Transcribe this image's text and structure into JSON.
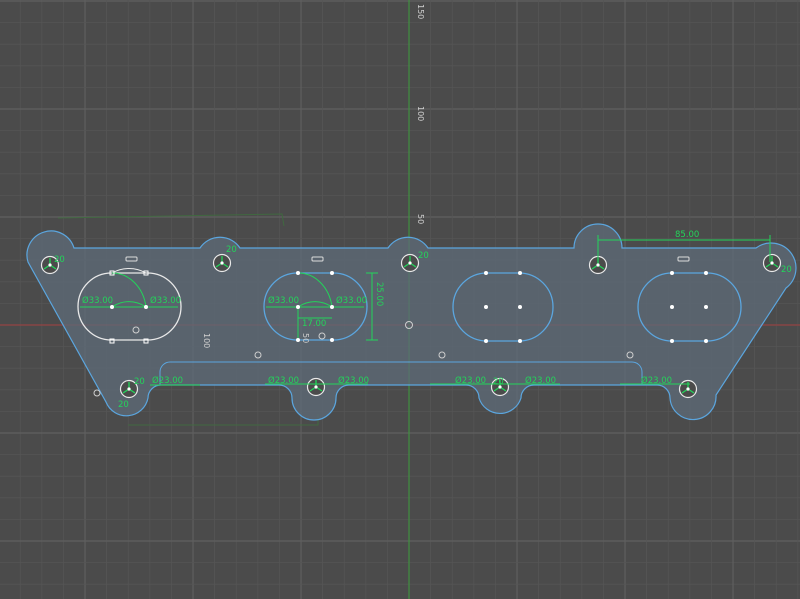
{
  "colors": {
    "background": "#4b4b4b",
    "grid_minor": "#555555",
    "grid_major": "#5f5f5f",
    "axis_y": "#3a9b3a",
    "axis_x": "#a23b3b",
    "profile_fill": "#5d6b78",
    "profile_stroke": "#5ba6df",
    "sketch_stroke": "#e9e9e9",
    "dimension": "#23d45a"
  },
  "axis_labels": {
    "y150": "150",
    "y100": "100",
    "y50": "50",
    "x100": "100",
    "x50": "50"
  },
  "dimensions": {
    "d1": "Ø33.00",
    "d2": "Ø33.00",
    "d3": "Ø33.00",
    "d4": "Ø33.00",
    "h25": "25.00",
    "w17": "17.00",
    "span85": "85.00",
    "b1": "Ø23.00",
    "b2": "Ø23.00",
    "b3": "Ø23.00",
    "b4": "Ø23.00",
    "b5": "Ø23.00",
    "b6": "Ø23.00",
    "t1": "20",
    "t2": "20",
    "t3": "20",
    "t4": "20",
    "t5": "20",
    "t6": "20",
    "t7": "20"
  }
}
